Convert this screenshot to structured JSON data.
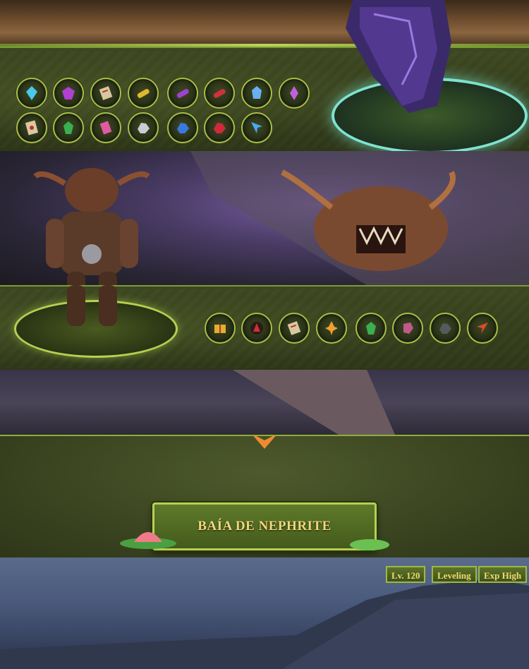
{
  "items_row_1": [
    "cyan-crystal-icon",
    "purple-gem-icon",
    "scroll-icon",
    "gold-scroll-icon",
    "purple-scroll-icon",
    "red-scroll-icon",
    "blue-crystal-icon",
    "violet-crystal-icon"
  ],
  "items_row_2": [
    "talisman-icon",
    "green-crystal-icon",
    "pink-shard-icon",
    "silver-ore-icon",
    "blue-ore-icon",
    "red-ore-icon",
    "blue-arrow-icon"
  ],
  "items_row_3": [
    "gold-chest-icon",
    "red-sigil-icon",
    "scroll-icon",
    "flame-crest-icon",
    "green-crystal-icon",
    "pink-stone-icon",
    "dark-ore-icon",
    "red-arrow-icon"
  ],
  "zone": {
    "title": "BAÍA DE NEPHRITE",
    "level": "Lv. 120",
    "type": "Leveling",
    "exp": "Exp High"
  },
  "colors": {
    "border": "#b6d050",
    "title": "#f0d87a",
    "panel": "#3d4720"
  }
}
